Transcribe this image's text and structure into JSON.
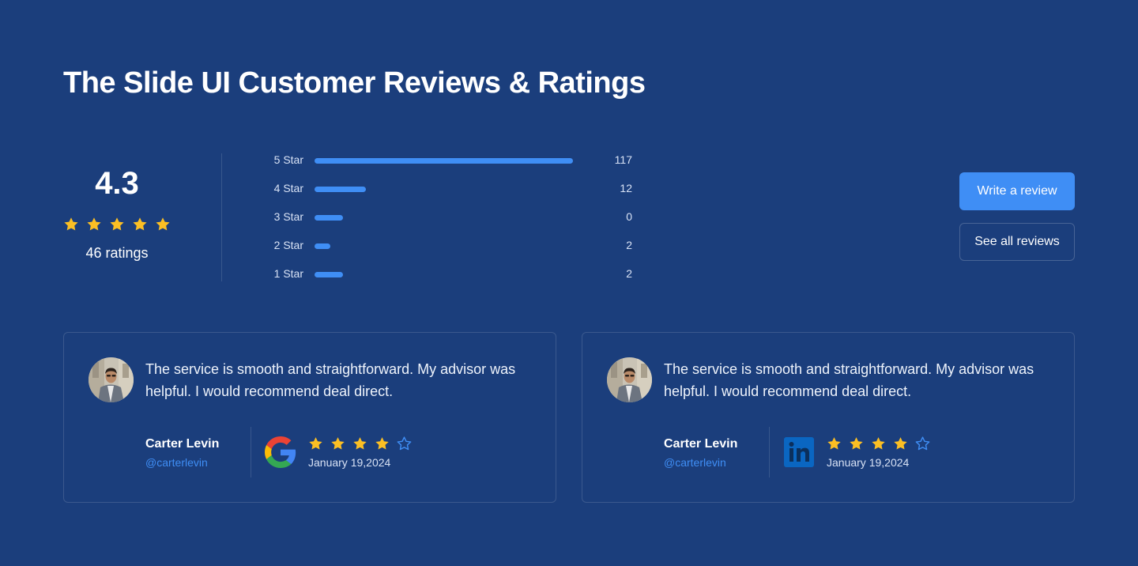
{
  "page": {
    "title": "The Slide UI Customer Reviews & Ratings"
  },
  "summary": {
    "average": "4.3",
    "stars": 5,
    "ratings_label": "46 ratings"
  },
  "breakdown": [
    {
      "label": "5 Star",
      "count": "117",
      "fill": 1.0
    },
    {
      "label": "4 Star",
      "count": "12",
      "fill": 0.2
    },
    {
      "label": "3 Star",
      "count": "0",
      "fill": 0.11
    },
    {
      "label": "2 Star",
      "count": "2",
      "fill": 0.06
    },
    {
      "label": "1 Star",
      "count": "2",
      "fill": 0.11
    }
  ],
  "actions": {
    "write_review": "Write a review",
    "see_all": "See all reviews"
  },
  "reviews": [
    {
      "text": "The service is smooth and straightforward. My advisor was helpful. I would recommend deal direct.",
      "name": "Carter Levin",
      "handle": "@carterlevin",
      "source": "google",
      "rating": 4,
      "date": "January 19,2024"
    },
    {
      "text": "The service is smooth and straightforward. My advisor was helpful. I would recommend deal direct.",
      "name": "Carter Levin",
      "handle": "@carterlevin",
      "source": "linkedin",
      "rating": 4,
      "date": "January 19,2024"
    }
  ],
  "colors": {
    "background": "#1b3e7c",
    "accent": "#3f8ef5",
    "star": "#fbbf24",
    "linkedin": "#0a66c2"
  },
  "icons": {
    "filled_star": "star-filled-icon",
    "empty_star": "star-outline-icon",
    "google": "google-logo-icon",
    "linkedin": "linkedin-logo-icon"
  }
}
